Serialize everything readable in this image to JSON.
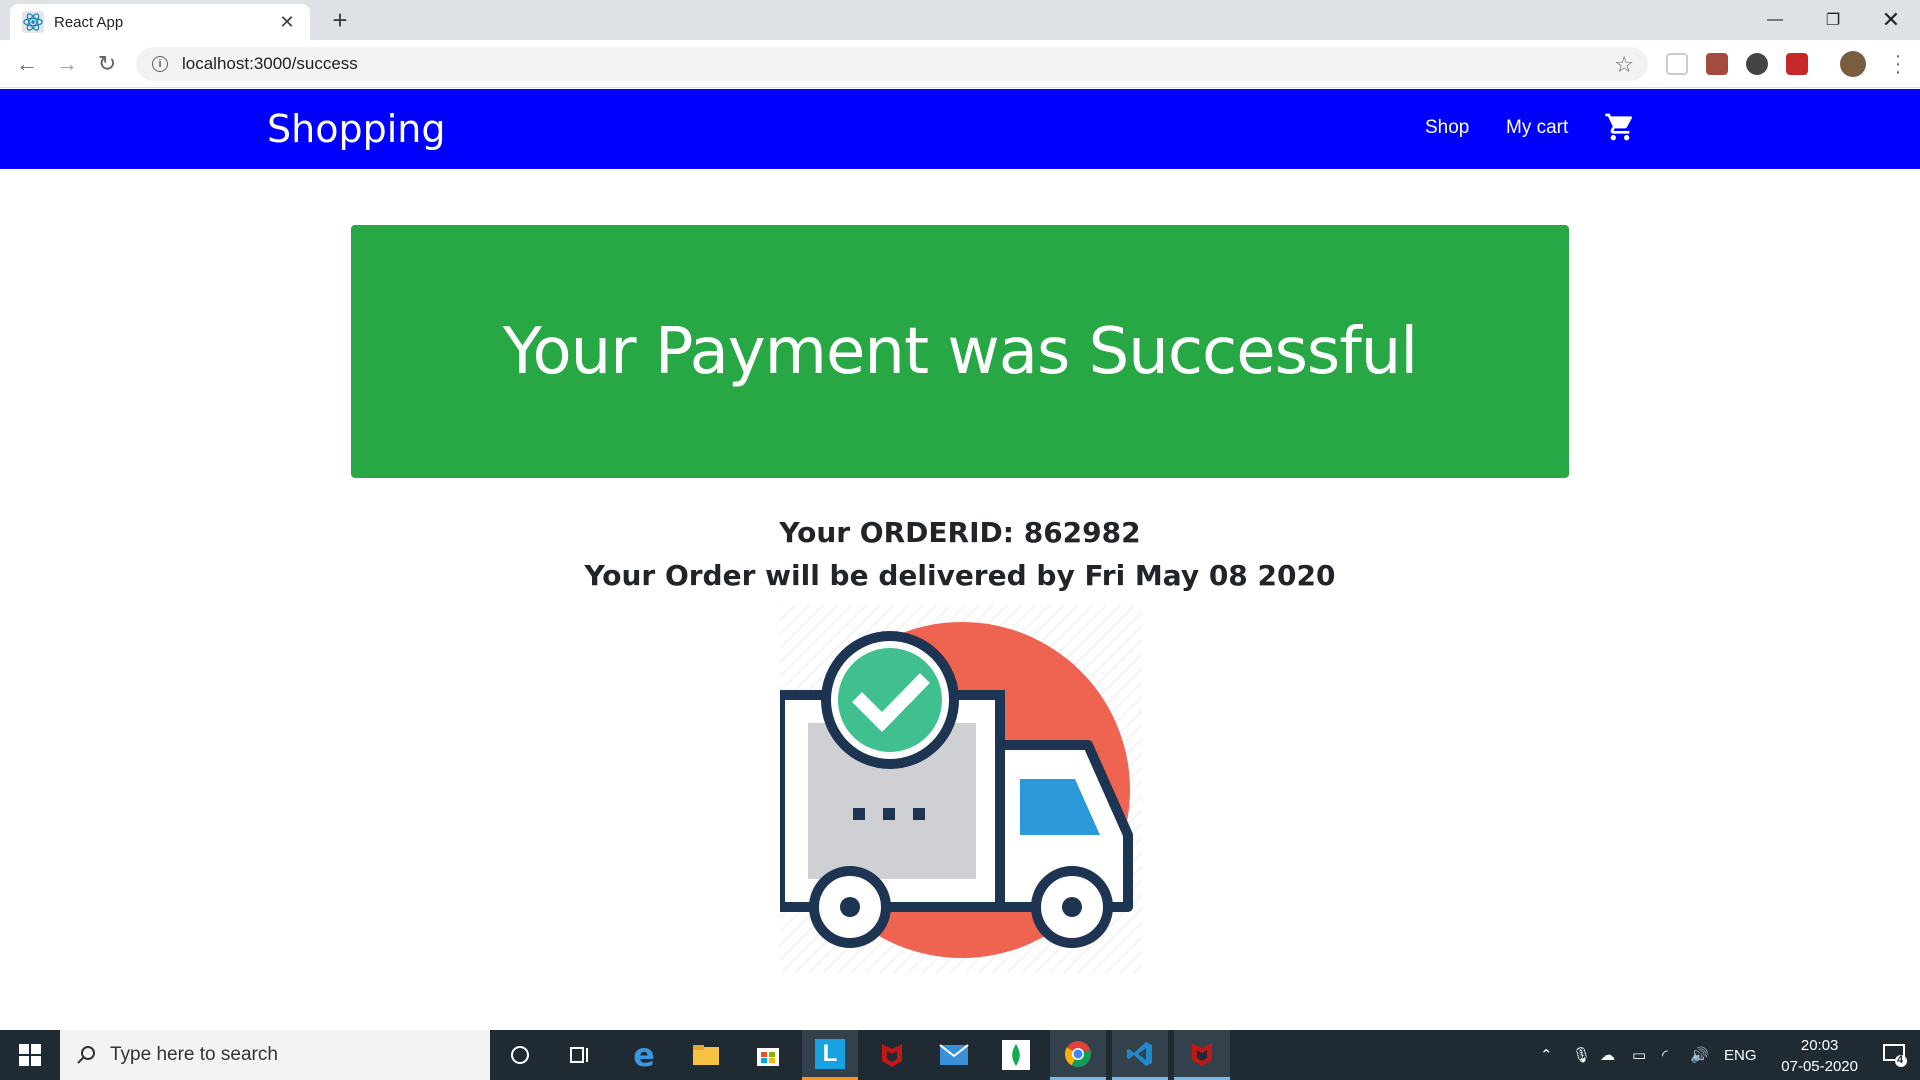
{
  "browser": {
    "tab_title": "React App",
    "url": "localhost:3000/success"
  },
  "navbar": {
    "brand": "Shopping",
    "links": [
      "Shop",
      "My cart"
    ],
    "background": "#0000ff"
  },
  "main": {
    "banner_title": "Your Payment was Successful",
    "banner_color": "#28a745",
    "order_id_line": "Your ORDERID: 862982",
    "delivery_line": "Your Order will be delivered by Fri May 08 2020",
    "illustration_icon": "delivery-truck-check-icon"
  },
  "taskbar": {
    "search_placeholder": "Type here to search",
    "language": "ENG",
    "time": "20:03",
    "date": "07-05-2020",
    "notification_count": "4"
  }
}
